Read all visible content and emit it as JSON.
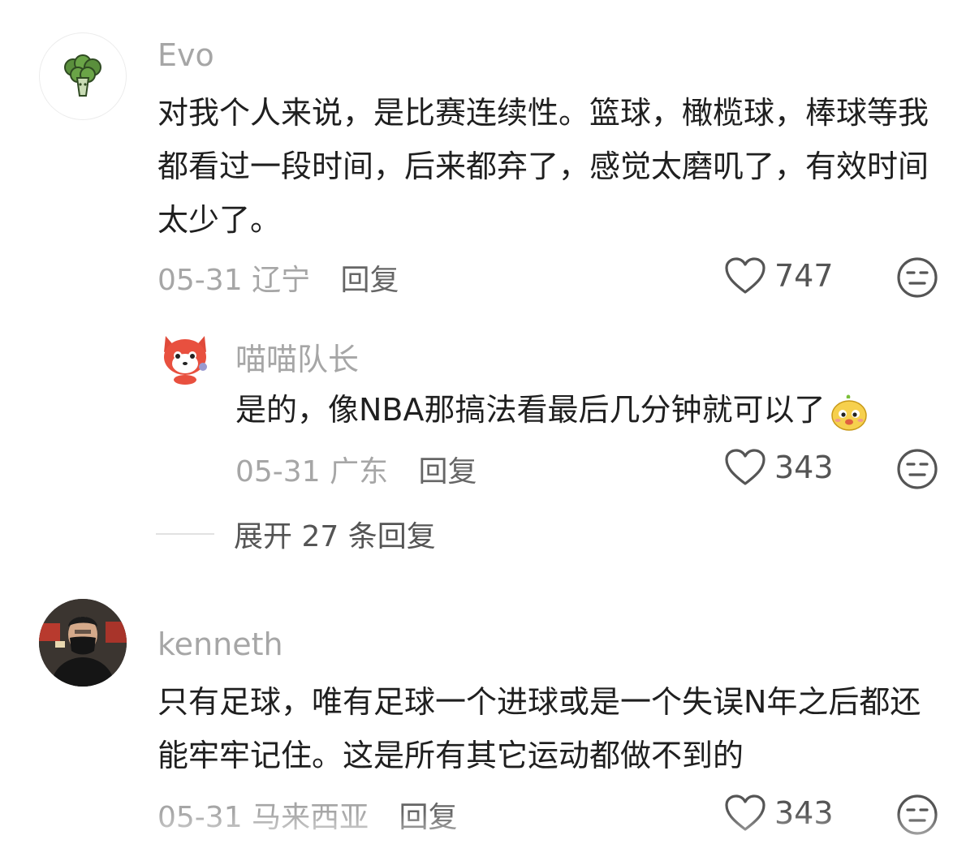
{
  "comments": [
    {
      "username": "Evo",
      "text": "对我个人来说，是比赛连续性。篮球，橄榄球，棒球等我都看过一段时间，后来都弃了，感觉太磨叽了，有效时间太少了。",
      "date": "05-31",
      "location": "辽宁",
      "reply_label": "回复",
      "likes": "747",
      "avatar_icon": "broccoli-icon"
    },
    {
      "username": "喵喵队长",
      "text": "是的，像NBA那搞法看最后几分钟就可以了",
      "date": "05-31",
      "location": "广东",
      "reply_label": "回复",
      "likes": "343",
      "avatar_icon": "red-panda-icon",
      "emoji": "chick-emoji-icon"
    },
    {
      "username": "kenneth",
      "text": "只有足球，唯有足球一个进球或是一个失误N年之后都还能牢牢记住。这是所有其它运动都做不到的",
      "date": "05-31",
      "location": "马来西亚",
      "reply_label": "回复",
      "likes": "343",
      "avatar_icon": "profile-photo-icon"
    }
  ],
  "expand_replies": "展开 27 条回复",
  "colors": {
    "muted": "#a6a6a6",
    "text": "#1f1f1f",
    "icon": "#555555"
  }
}
